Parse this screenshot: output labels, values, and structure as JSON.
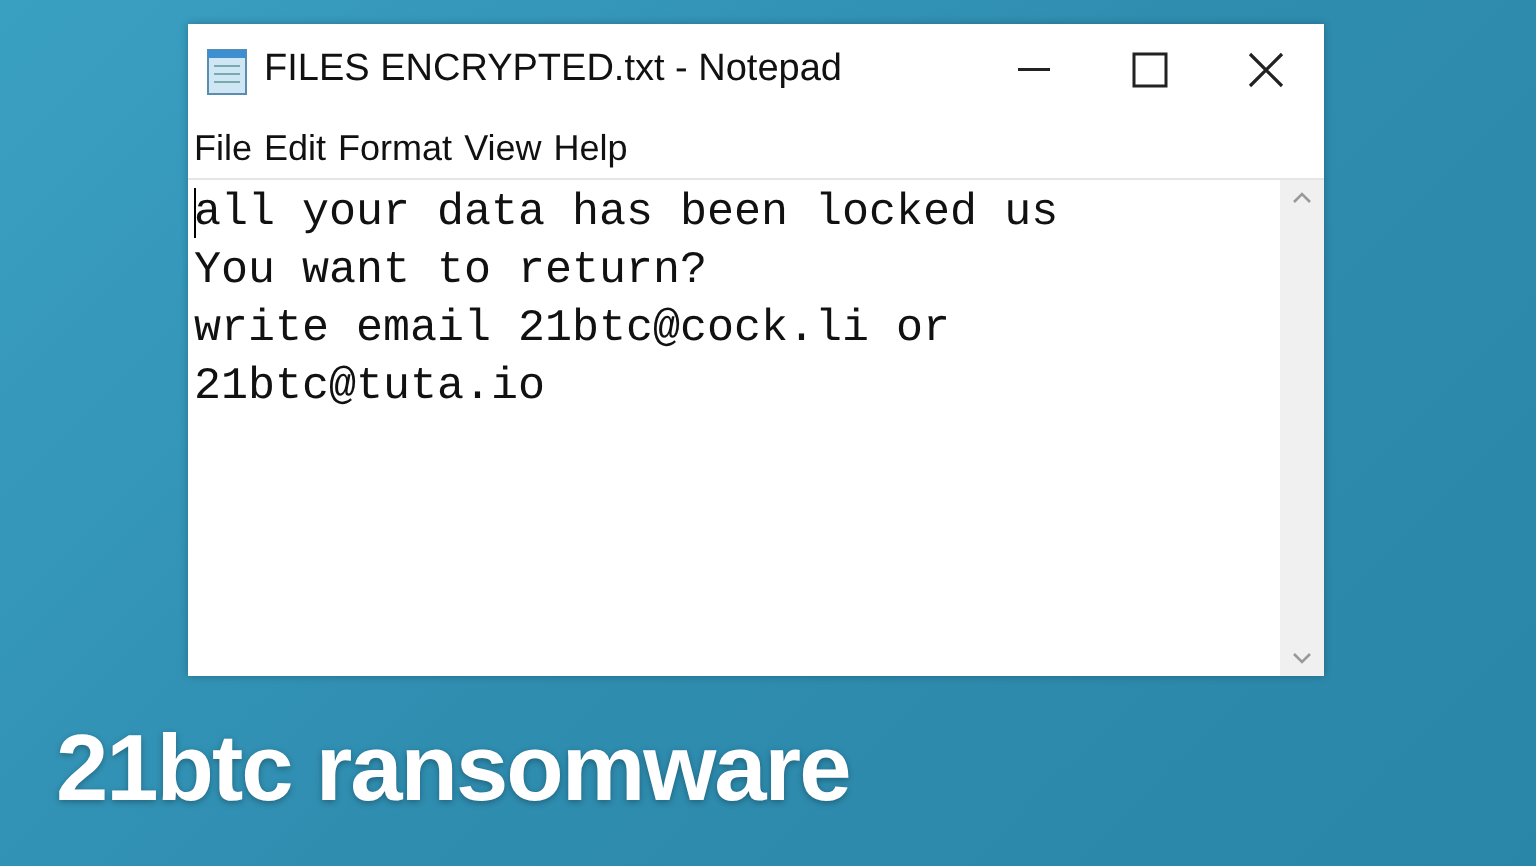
{
  "window": {
    "title": "FILES ENCRYPTED.txt - Notepad"
  },
  "menu": [
    "File",
    "Edit",
    "Format",
    "View",
    "Help"
  ],
  "document": {
    "lines": [
      "all your data has been locked us",
      "You want to return?",
      "write email 21btc@cock.li or",
      "21btc@tuta.io"
    ]
  },
  "caption": "21btc ransomware"
}
